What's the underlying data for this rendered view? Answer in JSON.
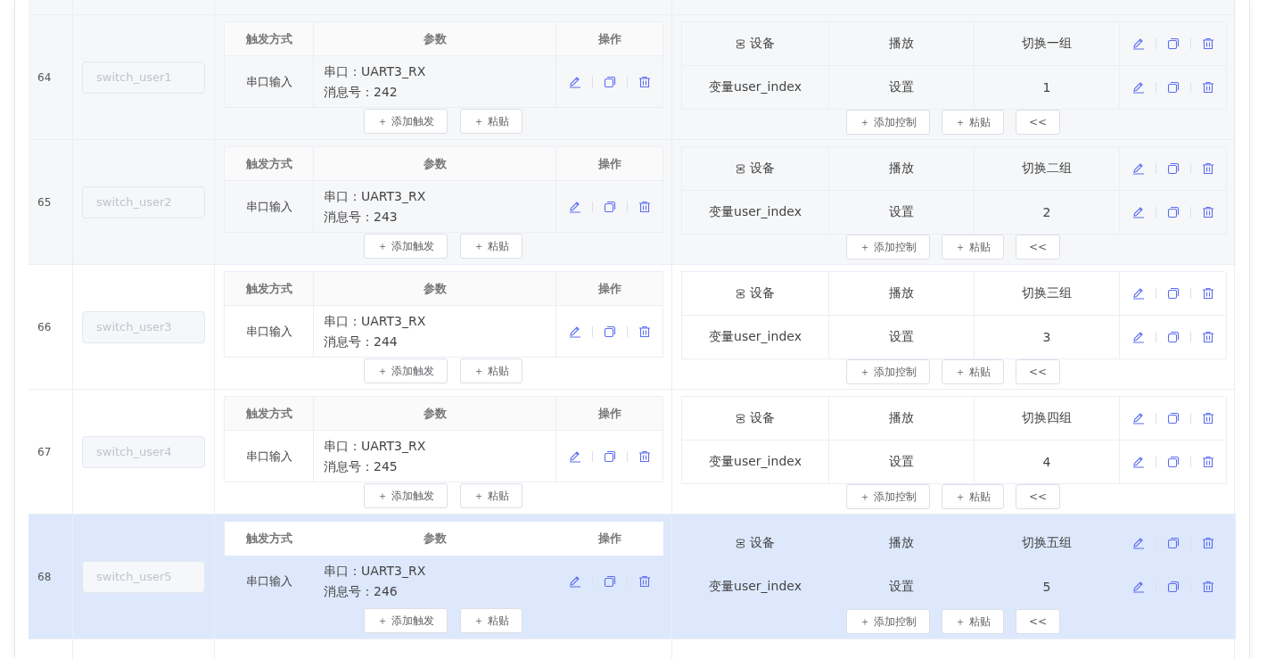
{
  "rows": [
    {
      "index": "64",
      "name": {
        "value": "switch_user1",
        "disabled": true
      },
      "shaded": true,
      "selected": false,
      "trigger_table": {
        "columns": [
          "触发方式",
          "参数",
          "操作"
        ],
        "rows": [
          {
            "method": "串口输入",
            "params": [
              "串口：UART3_RX",
              "消息号：242"
            ]
          }
        ]
      },
      "trigger_buttons": [
        {
          "icon": "＋",
          "label": "添加触发"
        },
        {
          "icon": "＋",
          "label": "粘贴"
        }
      ],
      "control_rows": [
        {
          "kind": "device",
          "cells": [
            "设备",
            "播放",
            "切换一组"
          ]
        },
        {
          "kind": "variable",
          "cells": [
            "变量user_index",
            "设置",
            "1"
          ]
        }
      ],
      "control_buttons": [
        {
          "icon": "＋",
          "label": "添加控制"
        },
        {
          "icon": "＋",
          "label": "粘贴"
        },
        {
          "label": "<<"
        }
      ]
    },
    {
      "index": "65",
      "name": {
        "value": "switch_user2",
        "disabled": true
      },
      "shaded": true,
      "selected": false,
      "trigger_table": {
        "columns": [
          "触发方式",
          "参数",
          "操作"
        ],
        "rows": [
          {
            "method": "串口输入",
            "params": [
              "串口：UART3_RX",
              "消息号：243"
            ]
          }
        ]
      },
      "trigger_buttons": [
        {
          "icon": "＋",
          "label": "添加触发"
        },
        {
          "icon": "＋",
          "label": "粘贴"
        }
      ],
      "control_rows": [
        {
          "kind": "device",
          "cells": [
            "设备",
            "播放",
            "切换二组"
          ]
        },
        {
          "kind": "variable",
          "cells": [
            "变量user_index",
            "设置",
            "2"
          ]
        }
      ],
      "control_buttons": [
        {
          "icon": "＋",
          "label": "添加控制"
        },
        {
          "icon": "＋",
          "label": "粘贴"
        },
        {
          "label": "<<"
        }
      ]
    },
    {
      "index": "66",
      "name": {
        "value": "switch_user3",
        "disabled": true
      },
      "shaded": false,
      "selected": false,
      "trigger_table": {
        "columns": [
          "触发方式",
          "参数",
          "操作"
        ],
        "rows": [
          {
            "method": "串口输入",
            "params": [
              "串口：UART3_RX",
              "消息号：244"
            ]
          }
        ]
      },
      "trigger_buttons": [
        {
          "icon": "＋",
          "label": "添加触发"
        },
        {
          "icon": "＋",
          "label": "粘贴"
        }
      ],
      "control_rows": [
        {
          "kind": "device",
          "cells": [
            "设备",
            "播放",
            "切换三组"
          ]
        },
        {
          "kind": "variable",
          "cells": [
            "变量user_index",
            "设置",
            "3"
          ]
        }
      ],
      "control_buttons": [
        {
          "icon": "＋",
          "label": "添加控制"
        },
        {
          "icon": "＋",
          "label": "粘贴"
        },
        {
          "label": "<<"
        }
      ]
    },
    {
      "index": "67",
      "name": {
        "value": "switch_user4",
        "disabled": true
      },
      "shaded": false,
      "selected": false,
      "trigger_table": {
        "columns": [
          "触发方式",
          "参数",
          "操作"
        ],
        "rows": [
          {
            "method": "串口输入",
            "params": [
              "串口：UART3_RX",
              "消息号：245"
            ]
          }
        ]
      },
      "trigger_buttons": [
        {
          "icon": "＋",
          "label": "添加触发"
        },
        {
          "icon": "＋",
          "label": "粘贴"
        }
      ],
      "control_rows": [
        {
          "kind": "device",
          "cells": [
            "设备",
            "播放",
            "切换四组"
          ]
        },
        {
          "kind": "variable",
          "cells": [
            "变量user_index",
            "设置",
            "4"
          ]
        }
      ],
      "control_buttons": [
        {
          "icon": "＋",
          "label": "添加控制"
        },
        {
          "icon": "＋",
          "label": "粘贴"
        },
        {
          "label": "<<"
        }
      ]
    },
    {
      "index": "68",
      "name": {
        "value": "switch_user5",
        "disabled": true
      },
      "shaded": false,
      "selected": true,
      "trigger_table": {
        "columns": [
          "触发方式",
          "参数",
          "操作"
        ],
        "rows": [
          {
            "method": "串口输入",
            "params": [
              "串口：UART3_RX",
              "消息号：246"
            ]
          }
        ]
      },
      "trigger_buttons": [
        {
          "icon": "＋",
          "label": "添加触发"
        },
        {
          "icon": "＋",
          "label": "粘贴"
        }
      ],
      "control_rows": [
        {
          "kind": "device",
          "cells": [
            "设备",
            "播放",
            "切换五组"
          ]
        },
        {
          "kind": "variable",
          "cells": [
            "变量user_index",
            "设置",
            "5"
          ]
        }
      ],
      "control_buttons": [
        {
          "icon": "＋",
          "label": "添加控制"
        },
        {
          "icon": "＋",
          "label": "粘贴"
        },
        {
          "label": "<<"
        }
      ]
    }
  ]
}
